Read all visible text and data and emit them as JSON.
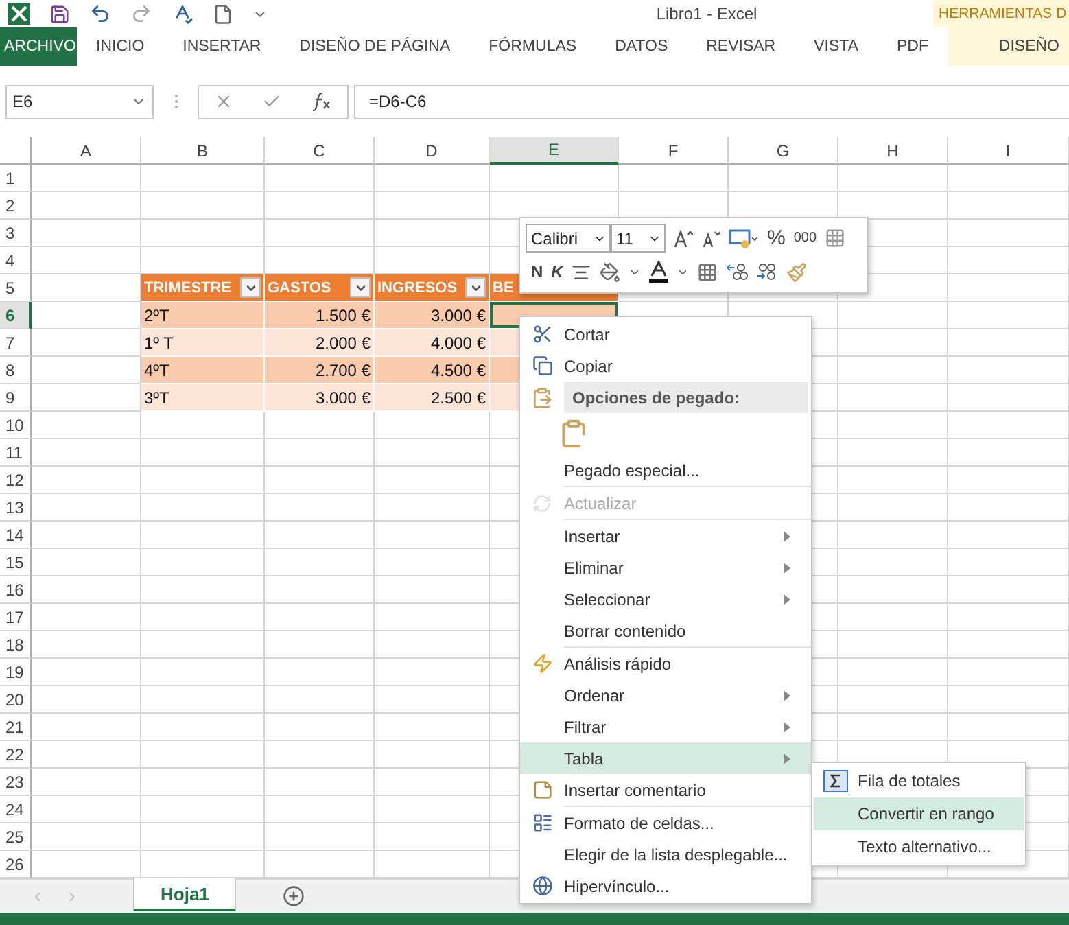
{
  "title_bar": {
    "title": "Libro1 - Excel",
    "contextual_group": "HERRAMIENTAS D"
  },
  "ribbon_tabs": [
    {
      "label": "ARCHIVO",
      "kind": "file",
      "selected": false
    },
    {
      "label": "INICIO",
      "kind": "tab",
      "selected": false
    },
    {
      "label": "INSERTAR",
      "kind": "tab",
      "selected": false
    },
    {
      "label": "DISEÑO DE PÁGINA",
      "kind": "tab",
      "selected": false
    },
    {
      "label": "FÓRMULAS",
      "kind": "tab",
      "selected": false
    },
    {
      "label": "DATOS",
      "kind": "tab",
      "selected": false
    },
    {
      "label": "REVISAR",
      "kind": "tab",
      "selected": false
    },
    {
      "label": "VISTA",
      "kind": "tab",
      "selected": false
    },
    {
      "label": "PDF",
      "kind": "tab",
      "selected": false
    },
    {
      "label": "DISEÑO",
      "kind": "contextual",
      "selected": false
    }
  ],
  "formula_bar": {
    "name_box": "E6",
    "formula": "=D6-C6"
  },
  "columns": [
    {
      "label": "A",
      "selected": false
    },
    {
      "label": "B",
      "selected": false
    },
    {
      "label": "C",
      "selected": false
    },
    {
      "label": "D",
      "selected": false
    },
    {
      "label": "E",
      "selected": true
    },
    {
      "label": "F",
      "selected": false
    },
    {
      "label": "G",
      "selected": false
    },
    {
      "label": "H",
      "selected": false
    },
    {
      "label": "I",
      "selected": false
    }
  ],
  "rows": [
    {
      "label": "1",
      "selected": false
    },
    {
      "label": "2",
      "selected": false
    },
    {
      "label": "3",
      "selected": false
    },
    {
      "label": "4",
      "selected": false
    },
    {
      "label": "5",
      "selected": false
    },
    {
      "label": "6",
      "selected": true
    },
    {
      "label": "7",
      "selected": false
    },
    {
      "label": "8",
      "selected": false
    },
    {
      "label": "9",
      "selected": false
    },
    {
      "label": "10",
      "selected": false
    },
    {
      "label": "11",
      "selected": false
    },
    {
      "label": "12",
      "selected": false
    },
    {
      "label": "13",
      "selected": false
    },
    {
      "label": "14",
      "selected": false
    },
    {
      "label": "15",
      "selected": false
    },
    {
      "label": "16",
      "selected": false
    },
    {
      "label": "17",
      "selected": false
    },
    {
      "label": "18",
      "selected": false
    },
    {
      "label": "19",
      "selected": false
    },
    {
      "label": "20",
      "selected": false
    },
    {
      "label": "21",
      "selected": false
    },
    {
      "label": "22",
      "selected": false
    },
    {
      "label": "23",
      "selected": false
    },
    {
      "label": "24",
      "selected": false
    },
    {
      "label": "25",
      "selected": false
    },
    {
      "label": "26",
      "selected": false
    }
  ],
  "table": {
    "header": [
      {
        "text": "TRIMESTRE",
        "filter": true
      },
      {
        "text": "GASTOS",
        "filter": true
      },
      {
        "text": "INGRESOS",
        "filter": true
      },
      {
        "text": "BE",
        "filter": false
      }
    ],
    "rows": [
      [
        "2ºT",
        "1.500 €",
        "3.000 €"
      ],
      [
        "1º T",
        "2.000 €",
        "4.000 €"
      ],
      [
        "4ºT",
        "2.700 €",
        "4.500 €"
      ],
      [
        "3ºT",
        "3.000 €",
        "2.500 €"
      ]
    ]
  },
  "mini_toolbar": {
    "font": "Calibri",
    "size": "11",
    "bold": "N",
    "italic": "K",
    "percent": "%",
    "thousands": "000"
  },
  "context_menu": [
    {
      "label": "Cortar",
      "kind": "cut",
      "submenu": false,
      "disabled": false,
      "selected": false
    },
    {
      "label": "Copiar",
      "kind": "copy",
      "submenu": false,
      "disabled": false,
      "selected": false
    },
    {
      "label": "Opciones de pegado:",
      "kind": "paste_header"
    },
    {
      "kind": "paste_button"
    },
    {
      "label": "Pegado especial...",
      "kind": "plain",
      "submenu": false,
      "disabled": false,
      "selected": false,
      "separator_after": true
    },
    {
      "label": "Actualizar",
      "kind": "refresh",
      "submenu": false,
      "disabled": true,
      "selected": false,
      "separator_after": true
    },
    {
      "label": "Insertar",
      "kind": "plain",
      "submenu": true,
      "disabled": false,
      "selected": false
    },
    {
      "label": "Eliminar",
      "kind": "plain",
      "submenu": true,
      "disabled": false,
      "selected": false
    },
    {
      "label": "Seleccionar",
      "kind": "plain",
      "submenu": true,
      "disabled": false,
      "selected": false
    },
    {
      "label": "Borrar contenido",
      "kind": "plain",
      "submenu": false,
      "disabled": false,
      "selected": false,
      "separator_after": true
    },
    {
      "label": "Análisis rápido",
      "kind": "quick_analysis",
      "submenu": false,
      "disabled": false,
      "selected": false
    },
    {
      "label": "Ordenar",
      "kind": "plain",
      "submenu": true,
      "disabled": false,
      "selected": false
    },
    {
      "label": "Filtrar",
      "kind": "plain",
      "submenu": true,
      "disabled": false,
      "selected": false
    },
    {
      "label": "Tabla",
      "kind": "plain",
      "submenu": true,
      "disabled": false,
      "selected": true
    },
    {
      "label": "Insertar comentario",
      "kind": "comment",
      "submenu": false,
      "disabled": false,
      "selected": false,
      "separator_after": true
    },
    {
      "label": "Formato de celdas...",
      "kind": "format",
      "submenu": false,
      "disabled": false,
      "selected": false
    },
    {
      "label": "Elegir de la lista desplegable...",
      "kind": "plain",
      "submenu": false,
      "disabled": false,
      "selected": false
    },
    {
      "label": "Hipervínculo...",
      "kind": "link",
      "submenu": false,
      "disabled": false,
      "selected": false
    }
  ],
  "submenu": [
    {
      "label": "Fila de totales",
      "kind": "sum",
      "selected": false
    },
    {
      "label": "Convertir en rango",
      "kind": "plain",
      "selected": true
    },
    {
      "label": "Texto alternativo...",
      "kind": "plain",
      "selected": false
    }
  ],
  "sheet_tabs": [
    {
      "label": "Hoja1",
      "selected": true
    }
  ]
}
